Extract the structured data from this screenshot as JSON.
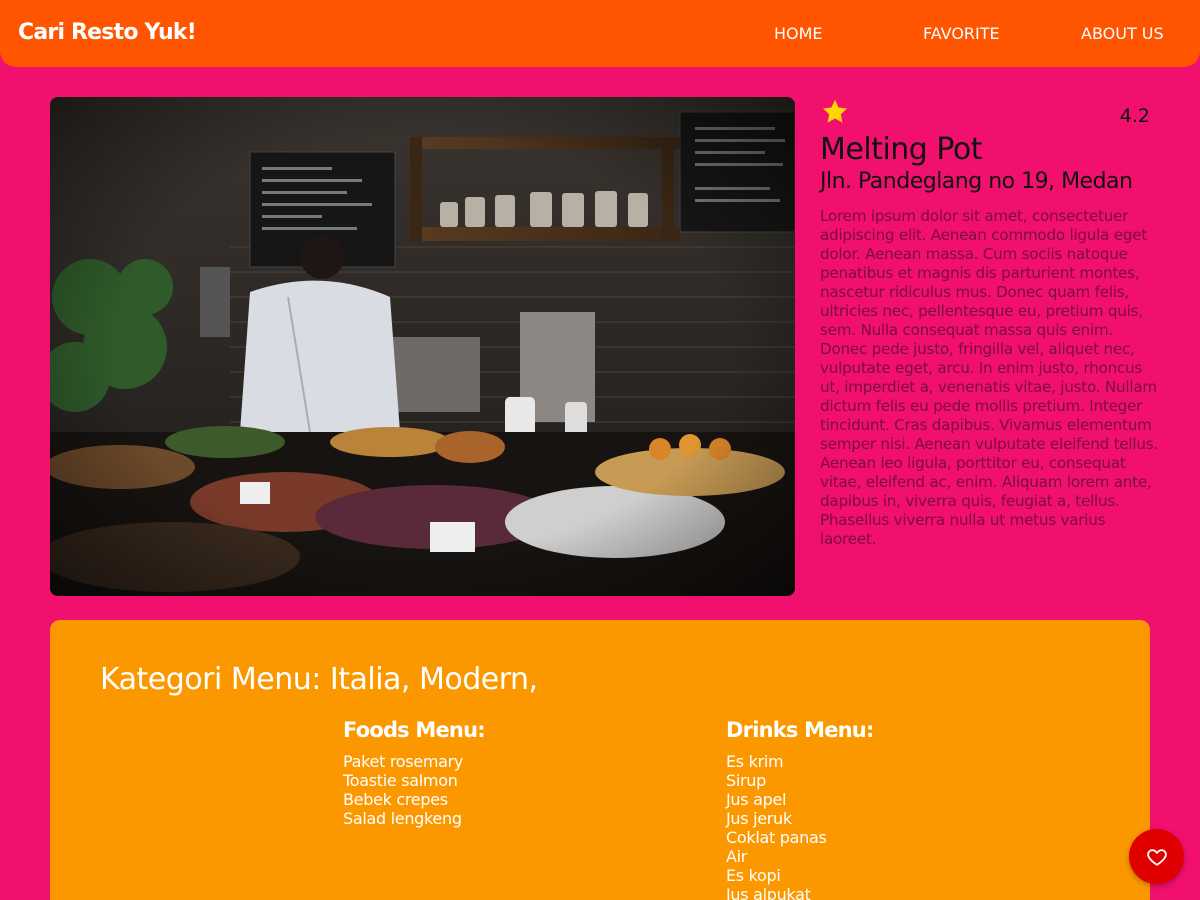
{
  "navbar": {
    "brand": "Cari Resto Yuk!",
    "links": [
      "HOME",
      "FAVORITE",
      "ABOUT US"
    ],
    "color": "#ff5500"
  },
  "restaurant": {
    "image_alt": "restaurant kitchen counter with chef",
    "rating": "4.2",
    "name": "Melting Pot",
    "address": "Jln. Pandeglang no 19, Medan",
    "description": "Lorem ipsum dolor sit amet, consectetuer adipiscing elit. Aenean commodo ligula eget dolor. Aenean massa. Cum sociis natoque penatibus et magnis dis parturient montes, nascetur ridiculus mus. Donec quam felis, ultricies nec, pellentesque eu, pretium quis, sem. Nulla consequat massa quis enim. Donec pede justo, fringilla vel, aliquet nec, vulputate eget, arcu. In enim justo, rhoncus ut, imperdiet a, venenatis vitae, justo. Nullam dictum felis eu pede mollis pretium. Integer tincidunt. Cras dapibus. Vivamus elementum semper nisi. Aenean vulputate eleifend tellus. Aenean leo ligula, porttitor eu, consequat vitae, eleifend ac, enim. Aliquam lorem ante, dapibus in, viverra quis, feugiat a, tellus. Phasellus viverra nulla ut metus varius laoreet."
  },
  "menu": {
    "category": "Kategori Menu: Italia, Modern,",
    "foods_title": "Foods Menu:",
    "foods": [
      "Paket rosemary",
      "Toastie salmon",
      "Bebek crepes",
      "Salad lengkeng"
    ],
    "drinks_title": "Drinks Menu:",
    "drinks": [
      "Es krim",
      "Sirup",
      "Jus apel",
      "Jus jeruk",
      "Coklat panas",
      "Air",
      "Es kopi",
      "Jus alpukat"
    ]
  },
  "fab": {
    "icon": "heart-icon"
  },
  "colors": {
    "page_bg": "#f2106e",
    "menu_bg": "#fb9800",
    "fab": "#e00000",
    "star": "#ffd400"
  }
}
